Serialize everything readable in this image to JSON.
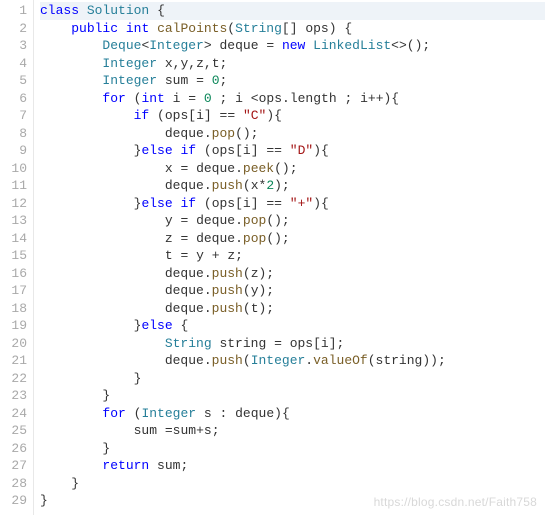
{
  "line_count": 29,
  "lines": {
    "l1": [
      [
        "kw",
        "class"
      ],
      [
        "sp",
        " "
      ],
      [
        "typ",
        "Solution"
      ],
      [
        "sp",
        " "
      ],
      [
        "pun",
        "{"
      ]
    ],
    "l2": [
      [
        "sp",
        "    "
      ],
      [
        "kw",
        "public"
      ],
      [
        "sp",
        " "
      ],
      [
        "kw",
        "int"
      ],
      [
        "sp",
        " "
      ],
      [
        "fn",
        "calPoints"
      ],
      [
        "pun",
        "("
      ],
      [
        "typ",
        "String"
      ],
      [
        "pun",
        "[]"
      ],
      [
        "sp",
        " "
      ],
      [
        "id",
        "ops"
      ],
      [
        "pun",
        ")"
      ],
      [
        "sp",
        " "
      ],
      [
        "pun",
        "{"
      ]
    ],
    "l3": [
      [
        "sp",
        "        "
      ],
      [
        "typ",
        "Deque"
      ],
      [
        "pun",
        "<"
      ],
      [
        "typ",
        "Integer"
      ],
      [
        "pun",
        ">"
      ],
      [
        "sp",
        " "
      ],
      [
        "id",
        "deque"
      ],
      [
        "sp",
        " "
      ],
      [
        "op",
        "="
      ],
      [
        "sp",
        " "
      ],
      [
        "kw",
        "new"
      ],
      [
        "sp",
        " "
      ],
      [
        "typ",
        "LinkedList"
      ],
      [
        "pun",
        "<>();"
      ]
    ],
    "l4": [
      [
        "sp",
        "        "
      ],
      [
        "typ",
        "Integer"
      ],
      [
        "sp",
        " "
      ],
      [
        "id",
        "x"
      ],
      [
        "pun",
        ","
      ],
      [
        "id",
        "y"
      ],
      [
        "pun",
        ","
      ],
      [
        "id",
        "z"
      ],
      [
        "pun",
        ","
      ],
      [
        "id",
        "t"
      ],
      [
        "pun",
        ";"
      ]
    ],
    "l5": [
      [
        "sp",
        "        "
      ],
      [
        "typ",
        "Integer"
      ],
      [
        "sp",
        " "
      ],
      [
        "id",
        "sum"
      ],
      [
        "sp",
        " "
      ],
      [
        "op",
        "="
      ],
      [
        "sp",
        " "
      ],
      [
        "num",
        "0"
      ],
      [
        "pun",
        ";"
      ]
    ],
    "l6": [
      [
        "sp",
        "        "
      ],
      [
        "kw",
        "for"
      ],
      [
        "sp",
        " "
      ],
      [
        "pun",
        "("
      ],
      [
        "kw",
        "int"
      ],
      [
        "sp",
        " "
      ],
      [
        "id",
        "i"
      ],
      [
        "sp",
        " "
      ],
      [
        "op",
        "="
      ],
      [
        "sp",
        " "
      ],
      [
        "num",
        "0"
      ],
      [
        "sp",
        " "
      ],
      [
        "pun",
        ";"
      ],
      [
        "sp",
        " "
      ],
      [
        "id",
        "i"
      ],
      [
        "sp",
        " "
      ],
      [
        "op",
        "<"
      ],
      [
        "id",
        "ops"
      ],
      [
        "pun",
        "."
      ],
      [
        "id",
        "length"
      ],
      [
        "sp",
        " "
      ],
      [
        "pun",
        ";"
      ],
      [
        "sp",
        " "
      ],
      [
        "id",
        "i"
      ],
      [
        "op",
        "++"
      ],
      [
        "pun",
        "){"
      ]
    ],
    "l7": [
      [
        "sp",
        "            "
      ],
      [
        "kw",
        "if"
      ],
      [
        "sp",
        " "
      ],
      [
        "pun",
        "("
      ],
      [
        "id",
        "ops"
      ],
      [
        "pun",
        "["
      ],
      [
        "id",
        "i"
      ],
      [
        "pun",
        "]"
      ],
      [
        "sp",
        " "
      ],
      [
        "op",
        "=="
      ],
      [
        "sp",
        " "
      ],
      [
        "str",
        "\"C\""
      ],
      [
        "pun",
        "){"
      ]
    ],
    "l8": [
      [
        "sp",
        "                "
      ],
      [
        "id",
        "deque"
      ],
      [
        "pun",
        "."
      ],
      [
        "fn",
        "pop"
      ],
      [
        "pun",
        "();"
      ]
    ],
    "l9": [
      [
        "sp",
        "            "
      ],
      [
        "pun",
        "}"
      ],
      [
        "kw",
        "else"
      ],
      [
        "sp",
        " "
      ],
      [
        "kw",
        "if"
      ],
      [
        "sp",
        " "
      ],
      [
        "pun",
        "("
      ],
      [
        "id",
        "ops"
      ],
      [
        "pun",
        "["
      ],
      [
        "id",
        "i"
      ],
      [
        "pun",
        "]"
      ],
      [
        "sp",
        " "
      ],
      [
        "op",
        "=="
      ],
      [
        "sp",
        " "
      ],
      [
        "str",
        "\"D\""
      ],
      [
        "pun",
        "){"
      ]
    ],
    "l10": [
      [
        "sp",
        "                "
      ],
      [
        "id",
        "x"
      ],
      [
        "sp",
        " "
      ],
      [
        "op",
        "="
      ],
      [
        "sp",
        " "
      ],
      [
        "id",
        "deque"
      ],
      [
        "pun",
        "."
      ],
      [
        "fn",
        "peek"
      ],
      [
        "pun",
        "();"
      ]
    ],
    "l11": [
      [
        "sp",
        "                "
      ],
      [
        "id",
        "deque"
      ],
      [
        "pun",
        "."
      ],
      [
        "fn",
        "push"
      ],
      [
        "pun",
        "("
      ],
      [
        "id",
        "x"
      ],
      [
        "op",
        "*"
      ],
      [
        "num",
        "2"
      ],
      [
        "pun",
        ");"
      ]
    ],
    "l12": [
      [
        "sp",
        "            "
      ],
      [
        "pun",
        "}"
      ],
      [
        "kw",
        "else"
      ],
      [
        "sp",
        " "
      ],
      [
        "kw",
        "if"
      ],
      [
        "sp",
        " "
      ],
      [
        "pun",
        "("
      ],
      [
        "id",
        "ops"
      ],
      [
        "pun",
        "["
      ],
      [
        "id",
        "i"
      ],
      [
        "pun",
        "]"
      ],
      [
        "sp",
        " "
      ],
      [
        "op",
        "=="
      ],
      [
        "sp",
        " "
      ],
      [
        "str",
        "\"+\""
      ],
      [
        "pun",
        "){"
      ]
    ],
    "l13": [
      [
        "sp",
        "                "
      ],
      [
        "id",
        "y"
      ],
      [
        "sp",
        " "
      ],
      [
        "op",
        "="
      ],
      [
        "sp",
        " "
      ],
      [
        "id",
        "deque"
      ],
      [
        "pun",
        "."
      ],
      [
        "fn",
        "pop"
      ],
      [
        "pun",
        "();"
      ]
    ],
    "l14": [
      [
        "sp",
        "                "
      ],
      [
        "id",
        "z"
      ],
      [
        "sp",
        " "
      ],
      [
        "op",
        "="
      ],
      [
        "sp",
        " "
      ],
      [
        "id",
        "deque"
      ],
      [
        "pun",
        "."
      ],
      [
        "fn",
        "pop"
      ],
      [
        "pun",
        "();"
      ]
    ],
    "l15": [
      [
        "sp",
        "                "
      ],
      [
        "id",
        "t"
      ],
      [
        "sp",
        " "
      ],
      [
        "op",
        "="
      ],
      [
        "sp",
        " "
      ],
      [
        "id",
        "y"
      ],
      [
        "sp",
        " "
      ],
      [
        "op",
        "+"
      ],
      [
        "sp",
        " "
      ],
      [
        "id",
        "z"
      ],
      [
        "pun",
        ";"
      ]
    ],
    "l16": [
      [
        "sp",
        "                "
      ],
      [
        "id",
        "deque"
      ],
      [
        "pun",
        "."
      ],
      [
        "fn",
        "push"
      ],
      [
        "pun",
        "("
      ],
      [
        "id",
        "z"
      ],
      [
        "pun",
        ");"
      ]
    ],
    "l17": [
      [
        "sp",
        "                "
      ],
      [
        "id",
        "deque"
      ],
      [
        "pun",
        "."
      ],
      [
        "fn",
        "push"
      ],
      [
        "pun",
        "("
      ],
      [
        "id",
        "y"
      ],
      [
        "pun",
        ");"
      ]
    ],
    "l18": [
      [
        "sp",
        "                "
      ],
      [
        "id",
        "deque"
      ],
      [
        "pun",
        "."
      ],
      [
        "fn",
        "push"
      ],
      [
        "pun",
        "("
      ],
      [
        "id",
        "t"
      ],
      [
        "pun",
        ");"
      ]
    ],
    "l19": [
      [
        "sp",
        "            "
      ],
      [
        "pun",
        "}"
      ],
      [
        "kw",
        "else"
      ],
      [
        "sp",
        " "
      ],
      [
        "pun",
        "{"
      ]
    ],
    "l20": [
      [
        "sp",
        "                "
      ],
      [
        "typ",
        "String"
      ],
      [
        "sp",
        " "
      ],
      [
        "id",
        "string"
      ],
      [
        "sp",
        " "
      ],
      [
        "op",
        "="
      ],
      [
        "sp",
        " "
      ],
      [
        "id",
        "ops"
      ],
      [
        "pun",
        "["
      ],
      [
        "id",
        "i"
      ],
      [
        "pun",
        "];"
      ]
    ],
    "l21": [
      [
        "sp",
        "                "
      ],
      [
        "id",
        "deque"
      ],
      [
        "pun",
        "."
      ],
      [
        "fn",
        "push"
      ],
      [
        "pun",
        "("
      ],
      [
        "typ",
        "Integer"
      ],
      [
        "pun",
        "."
      ],
      [
        "fn",
        "valueOf"
      ],
      [
        "pun",
        "("
      ],
      [
        "id",
        "string"
      ],
      [
        "pun",
        "));"
      ]
    ],
    "l22": [
      [
        "sp",
        "            "
      ],
      [
        "pun",
        "}"
      ]
    ],
    "l23": [
      [
        "sp",
        "        "
      ],
      [
        "pun",
        "}"
      ]
    ],
    "l24": [
      [
        "sp",
        "        "
      ],
      [
        "kw",
        "for"
      ],
      [
        "sp",
        " "
      ],
      [
        "pun",
        "("
      ],
      [
        "typ",
        "Integer"
      ],
      [
        "sp",
        " "
      ],
      [
        "id",
        "s"
      ],
      [
        "sp",
        " "
      ],
      [
        "pun",
        ":"
      ],
      [
        "sp",
        " "
      ],
      [
        "id",
        "deque"
      ],
      [
        "pun",
        "){"
      ]
    ],
    "l25": [
      [
        "sp",
        "            "
      ],
      [
        "id",
        "sum"
      ],
      [
        "sp",
        " "
      ],
      [
        "op",
        "="
      ],
      [
        "id",
        "sum"
      ],
      [
        "op",
        "+"
      ],
      [
        "id",
        "s"
      ],
      [
        "pun",
        ";"
      ]
    ],
    "l26": [
      [
        "sp",
        "        "
      ],
      [
        "pun",
        "}"
      ]
    ],
    "l27": [
      [
        "sp",
        "        "
      ],
      [
        "kw",
        "return"
      ],
      [
        "sp",
        " "
      ],
      [
        "id",
        "sum"
      ],
      [
        "pun",
        ";"
      ]
    ],
    "l28": [
      [
        "sp",
        "    "
      ],
      [
        "pun",
        "}"
      ]
    ],
    "l29": [
      [
        "pun",
        "}"
      ]
    ]
  },
  "active_line": 1,
  "watermark": "https://blog.csdn.net/Faith758"
}
